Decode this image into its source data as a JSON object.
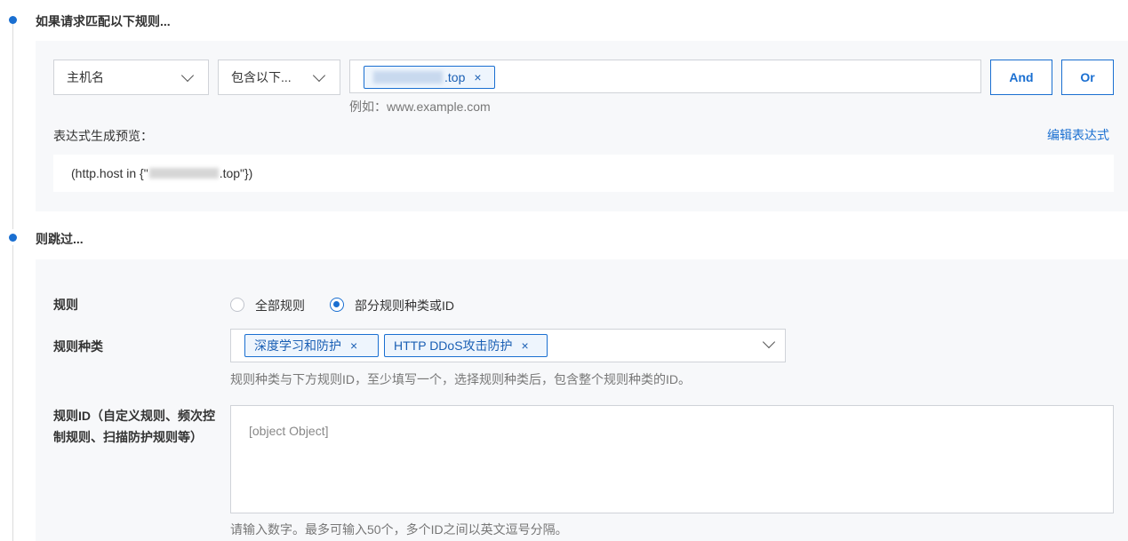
{
  "section1": {
    "title": "如果请求匹配以下规则...",
    "field_select": "主机名",
    "operator_select": "包含以下...",
    "host_tag_suffix": ".top",
    "host_tag_close": "×",
    "example_hint": "例如：www.example.com",
    "and_button": "And",
    "or_button": "Or",
    "preview_label": "表达式生成预览：",
    "edit_expression_link": "编辑表达式",
    "preview_prefix": "(http.host in {\"",
    "preview_suffix": ".top\"})"
  },
  "section2": {
    "title": "则跳过...",
    "rules_label": "规则",
    "radio_all": "全部规则",
    "radio_partial": "部分规则种类或ID",
    "rule_types_label": "规则种类",
    "rule_type_tags": [
      {
        "label": "深度学习和防护",
        "close": "×"
      },
      {
        "label": "HTTP DDoS攻击防护",
        "close": "×"
      }
    ],
    "rule_types_hint": "规则种类与下方规则ID，至少填写一个，选择规则种类后，包含整个规则种类的ID。",
    "rule_id_label": "规则ID（自定义规则、频次控制规则、扫描防护规则等）",
    "rule_id_value": "[object Object]",
    "rule_id_hint": "请输入数字。最多可输入50个，多个ID之间以英文逗号分隔。"
  },
  "colors": {
    "accent": "#1a6fd1",
    "panel_bg": "#f7f8fa"
  },
  "selected_radio": "partial"
}
